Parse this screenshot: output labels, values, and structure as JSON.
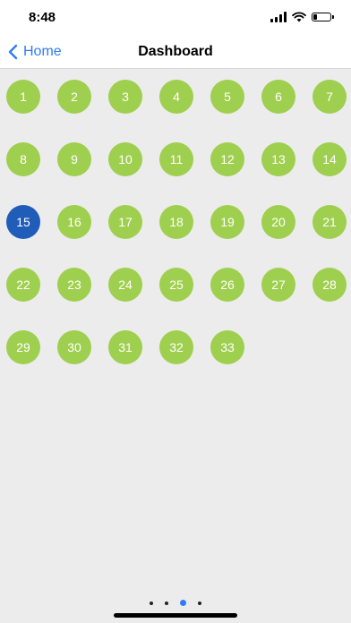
{
  "status_bar": {
    "time": "8:48",
    "battery_level": 0.25
  },
  "nav": {
    "back_label": "Home",
    "title": "Dashboard"
  },
  "days": [
    "1",
    "2",
    "3",
    "4",
    "5",
    "6",
    "7",
    "8",
    "9",
    "10",
    "11",
    "12",
    "13",
    "14",
    "15",
    "16",
    "17",
    "18",
    "19",
    "20",
    "21",
    "22",
    "23",
    "24",
    "25",
    "26",
    "27",
    "28",
    "29",
    "30",
    "31",
    "32",
    "33"
  ],
  "selected_day": "15",
  "colors": {
    "day_default": "#9fcf4f",
    "day_selected": "#1f5db8",
    "accent": "#2f7cf6",
    "background": "#ececec"
  },
  "page_indicator": {
    "count": 4,
    "active_index": 2
  }
}
